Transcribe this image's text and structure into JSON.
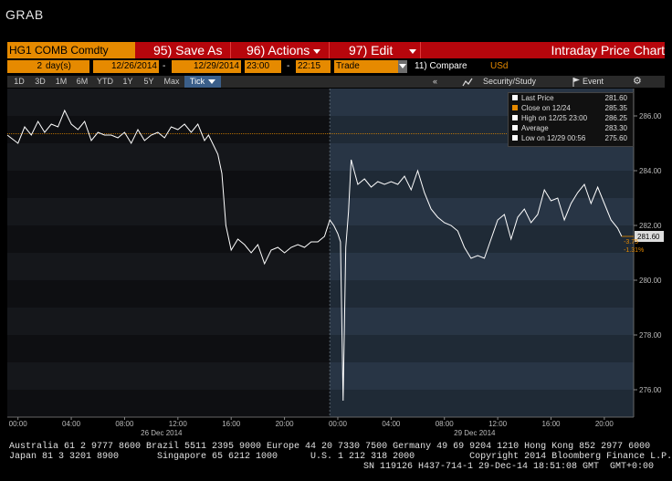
{
  "window_title": "GRAB",
  "toolbar": {
    "ticker": "HG1 COMB Comdty",
    "save_as": "95) Save As",
    "actions": "96) Actions",
    "edit": "97) Edit",
    "chart_title": "Intraday Price Chart"
  },
  "params": {
    "period_count": "2",
    "period_unit": "day(s)",
    "start_date": "12/26/2014",
    "dash1": "-",
    "end_date": "12/29/2014",
    "start_time": "23:00",
    "dash2": "-",
    "end_time": "22:15",
    "event": "Trade",
    "compare": "11) Compare",
    "currency": "USd"
  },
  "ranges": [
    "1D",
    "3D",
    "1M",
    "6M",
    "YTD",
    "1Y",
    "5Y",
    "Max",
    "Tick"
  ],
  "right_tools": {
    "collapse": "«",
    "security_study": "Security/Study",
    "event": "Event"
  },
  "legend": [
    {
      "label": "Last Price",
      "value": "281.60",
      "color": "#ffffff"
    },
    {
      "label": "Close on 12/24",
      "value": "285.35",
      "color": "#e68a00"
    },
    {
      "label": "High on 12/25 23:00",
      "value": "286.25",
      "color": "#ffffff"
    },
    {
      "label": "Average",
      "value": "283.30",
      "color": "#ffffff"
    },
    {
      "label": "Low on 12/29 00:56",
      "value": "275.60",
      "color": "#ffffff"
    }
  ],
  "annotations": {
    "last_price_tag": "281.60",
    "change": "-3.75",
    "change_pct": "-1.31%"
  },
  "colors": {
    "accent_orange": "#e68a00",
    "toolbar_red": "#b7060c",
    "price_line": "#ffffff"
  },
  "chart_data": {
    "type": "line",
    "title": "",
    "xlabel": "",
    "ylabel": "",
    "ylim": [
      275.0,
      287.0
    ],
    "y_ticks": [
      "276.00",
      "278.00",
      "280.00",
      "282.00",
      "284.00",
      "286.00"
    ],
    "x_tick_labels": [
      "00:00",
      "04:00",
      "08:00",
      "12:00",
      "16:00",
      "20:00",
      "00:00",
      "04:00",
      "08:00",
      "12:00",
      "16:00",
      "20:00"
    ],
    "x_day_labels": [
      "26 Dec 2014",
      "29 Dec 2014"
    ],
    "x_range_hours": [
      -0.8,
      46.2
    ],
    "reference_close": 285.35,
    "grid": true,
    "series": [
      {
        "x": [
          -0.8,
          0,
          0.5,
          1,
          1.5,
          2,
          2.5,
          3,
          3.5,
          4,
          4.5,
          5,
          5.5,
          6,
          6.5,
          7,
          7.5,
          8,
          8.5,
          9,
          9.5,
          10,
          10.5,
          11,
          11.5,
          12,
          12.5,
          13,
          13.5,
          14,
          14.3,
          14.6,
          15,
          15.3,
          15.6,
          16,
          16.5,
          17,
          17.5,
          18,
          18.5,
          19,
          19.5,
          20,
          20.5,
          21,
          21.5,
          22,
          22.5,
          23,
          23.4,
          23.7,
          24,
          24.2,
          24.4,
          24.6,
          24.8,
          25,
          25.5,
          26,
          26.5,
          27,
          27.5,
          28,
          28.5,
          29,
          29.5,
          30,
          30.5,
          31,
          31.5,
          32,
          32.5,
          33,
          33.5,
          34,
          34.5,
          35,
          35.5,
          36,
          36.5,
          37,
          37.5,
          38,
          38.5,
          39,
          39.5,
          40,
          40.5,
          41,
          41.5,
          42,
          42.5,
          43,
          43.5,
          44,
          44.5,
          45,
          45.3
        ],
        "y": [
          285.3,
          285.0,
          285.6,
          285.3,
          285.8,
          285.4,
          285.7,
          285.6,
          286.2,
          285.7,
          285.5,
          285.8,
          285.1,
          285.4,
          285.3,
          285.3,
          285.2,
          285.4,
          285.0,
          285.5,
          285.1,
          285.3,
          285.4,
          285.2,
          285.6,
          285.5,
          285.7,
          285.4,
          285.7,
          285.1,
          285.3,
          285.0,
          284.6,
          283.9,
          282.0,
          281.1,
          281.5,
          281.3,
          281.0,
          281.3,
          280.6,
          281.1,
          281.2,
          281.0,
          281.2,
          281.3,
          281.2,
          281.4,
          281.4,
          281.6,
          282.2,
          282.0,
          281.7,
          281.4,
          275.6,
          281.2,
          282.5,
          284.4,
          283.5,
          283.7,
          283.4,
          283.6,
          283.5,
          283.6,
          283.5,
          283.8,
          283.3,
          284.0,
          283.2,
          282.6,
          282.3,
          282.1,
          282.0,
          281.8,
          281.2,
          280.8,
          280.9,
          280.8,
          281.5,
          282.2,
          282.4,
          281.5,
          282.3,
          282.6,
          282.1,
          282.4,
          283.3,
          282.9,
          283.0,
          282.2,
          282.8,
          283.2,
          283.5,
          282.8,
          283.4,
          282.8,
          282.2,
          281.9,
          281.6
        ]
      }
    ]
  },
  "footer": {
    "line1": "Australia 61 2 9777 8600 Brazil 5511 2395 9000 Europe 44 20 7330 7500 Germany 49 69 9204 1210 Hong Kong 852 2977 6000",
    "line2": "Japan 81 3 3201 8900       Singapore 65 6212 1000      U.S. 1 212 318 2000          Copyright 2014 Bloomberg Finance L.P.",
    "line3": "SN 119126 H437-714-1 29-Dec-14 18:51:08 GMT  GMT+0:00"
  }
}
